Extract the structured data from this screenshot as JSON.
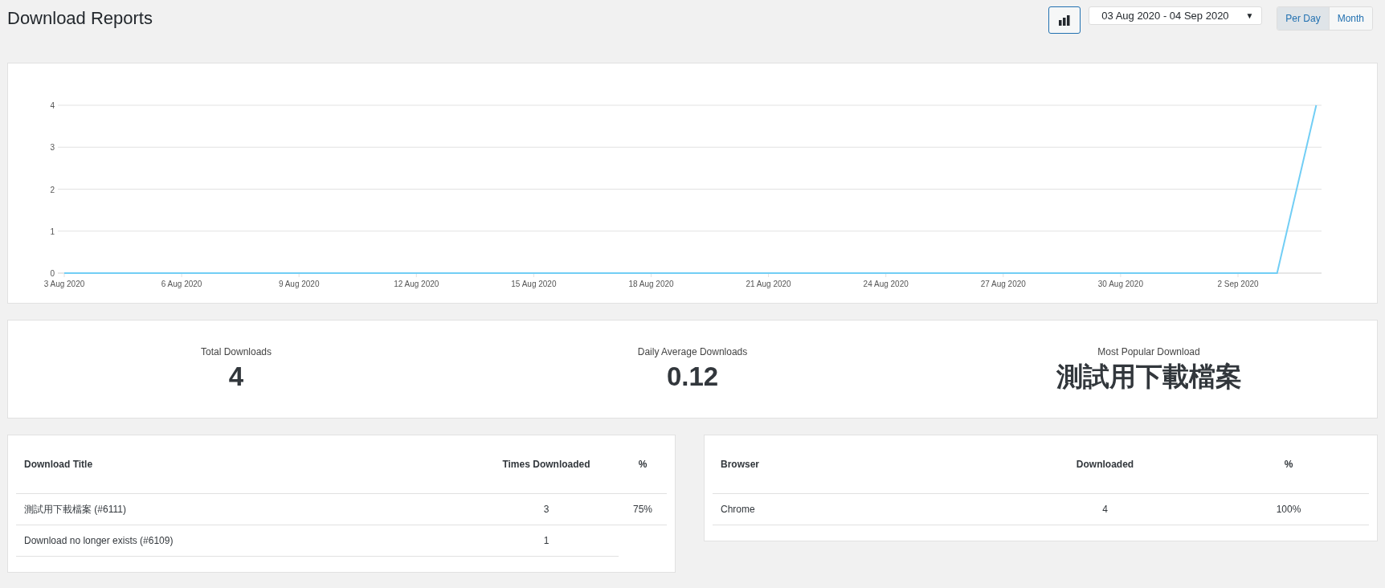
{
  "page_title": "Download Reports",
  "toolbar": {
    "chart_button": {
      "selected": true
    },
    "date_range": "03 Aug 2020 - 04 Sep 2020",
    "date_range_caret": "▼",
    "period_tabs": [
      {
        "label": "Per Day",
        "selected": true
      },
      {
        "label": "Month",
        "selected": false
      }
    ]
  },
  "chart": {
    "chart_data": {
      "type": "line",
      "categories": [
        "3 Aug 2020",
        null,
        null,
        "6 Aug 2020",
        null,
        null,
        "9 Aug 2020",
        null,
        null,
        "12 Aug 2020",
        null,
        null,
        "15 Aug 2020",
        null,
        null,
        "18 Aug 2020",
        null,
        null,
        "21 Aug 2020",
        null,
        null,
        "24 Aug 2020",
        null,
        null,
        "27 Aug 2020",
        null,
        null,
        "30 Aug 2020",
        null,
        null,
        "2 Sep 2020",
        null,
        null
      ],
      "series": [
        {
          "color": "#72cef5",
          "values": [
            0,
            0,
            0,
            0,
            0,
            0,
            0,
            0,
            0,
            0,
            0,
            0,
            0,
            0,
            0,
            0,
            0,
            0,
            0,
            0,
            0,
            0,
            0,
            0,
            0,
            0,
            0,
            0,
            0,
            0,
            0,
            0,
            4
          ]
        }
      ],
      "ylim": [
        0,
        4
      ],
      "yticks": [
        0,
        1,
        2,
        3,
        4
      ],
      "grid": true
    }
  },
  "stats": [
    {
      "label": "Total Downloads",
      "value": "4"
    },
    {
      "label": "Daily Average Downloads",
      "value": "0.12"
    },
    {
      "label": "Most Popular Download",
      "value": "測試用下載檔案"
    }
  ],
  "downloads_table": {
    "columns": [
      "Download Title",
      "Times Downloaded",
      "%"
    ],
    "rows": [
      [
        "測試用下載檔案 (#6111)",
        "3",
        "75%"
      ],
      [
        "Download no longer exists (#6109)",
        "1"
      ]
    ]
  },
  "browser_table": {
    "columns": [
      "Browser",
      "Downloaded",
      "%"
    ],
    "rows": [
      [
        "Chrome",
        "4",
        "100%"
      ]
    ]
  }
}
